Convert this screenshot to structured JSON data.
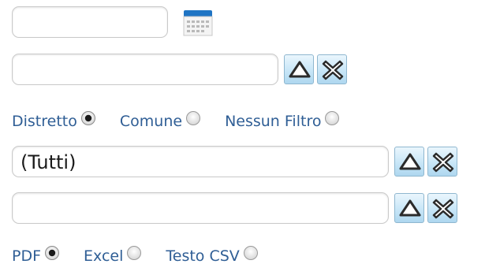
{
  "date_field": {
    "value": ""
  },
  "lookup_field_1": {
    "value": ""
  },
  "filter_options": [
    {
      "label": "Distretto",
      "selected": true
    },
    {
      "label": "Comune",
      "selected": false
    },
    {
      "label": "Nessun Filtro",
      "selected": false
    }
  ],
  "filter_value_field": {
    "value": "(Tutti)"
  },
  "lookup_field_2": {
    "value": ""
  },
  "format_options": [
    {
      "label": "PDF",
      "selected": true
    },
    {
      "label": "Excel",
      "selected": false
    },
    {
      "label": "Testo CSV",
      "selected": false
    }
  ],
  "icons": {
    "calendar": "calendar-icon",
    "open_lookup": "triangle-up-icon",
    "clear": "x-icon"
  },
  "colors": {
    "label_blue": "#2f5e95",
    "button_blue": "#c8e6f7",
    "calendar_blue": "#1f74c4"
  }
}
